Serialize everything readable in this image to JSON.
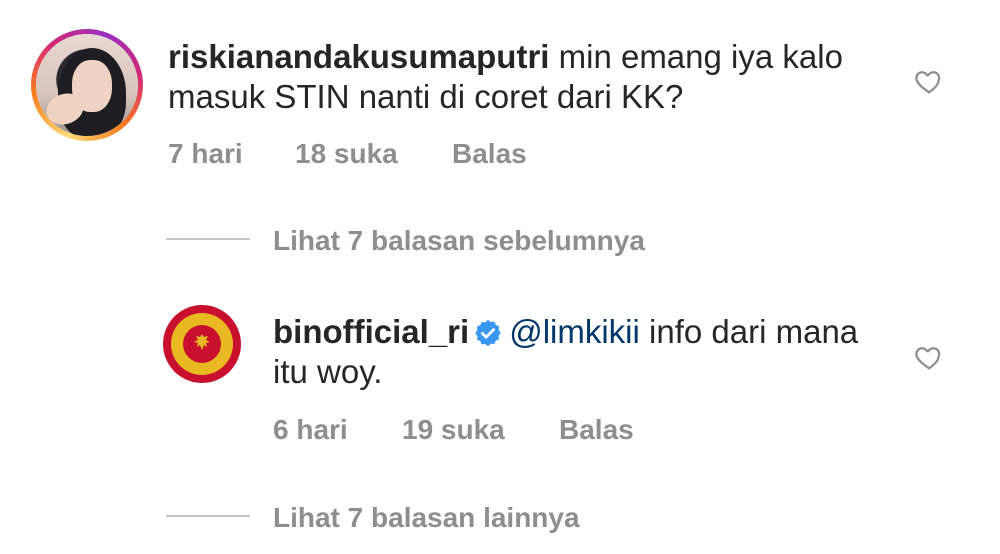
{
  "comment1": {
    "username": "riskianandakusumaputri",
    "text": " min emang iya kalo masuk STIN nanti di coret dari KK?",
    "time": "7 hari",
    "likes": "18 suka",
    "reply": "Balas",
    "view_replies": "Lihat 7 balasan sebelumnya"
  },
  "comment2": {
    "username": "binofficial_ri",
    "mention": "@limkikii",
    "text": " info dari mana itu woy.",
    "time": "6 hari",
    "likes": "19 suka",
    "reply": "Balas",
    "view_replies": "Lihat 7 balasan lainnya"
  },
  "icons": {
    "heart": "heart-outline-icon",
    "verified": "verified-badge-icon"
  },
  "colors": {
    "text": "#262626",
    "muted": "#8e8e8e",
    "verified": "#3897f0",
    "mention": "#00376b"
  }
}
